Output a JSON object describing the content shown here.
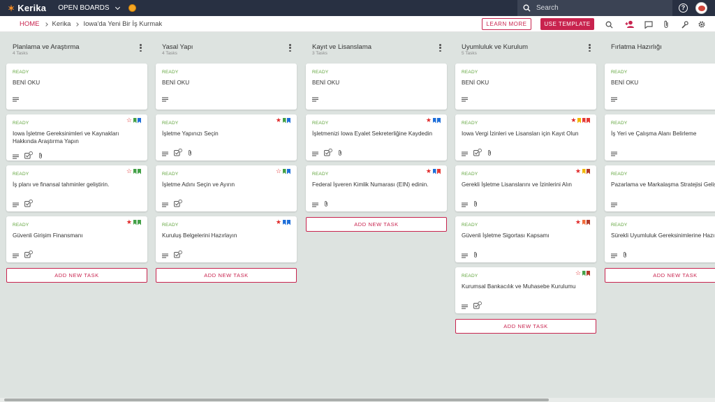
{
  "app": {
    "logo_text": "Kerika",
    "open_boards": "OPEN BOARDS",
    "search_placeholder": "Search"
  },
  "breadcrumb": {
    "home": "HOME",
    "org": "Kerika",
    "board": "Iowa'da Yeni Bir İş Kurmak"
  },
  "actions": {
    "learn_more": "LEARN MORE",
    "use_template": "USE TEMPLATE"
  },
  "colors": {
    "accent": "#c8234e",
    "topbar": "#283042",
    "ready": "#5fa33a",
    "board_bg": "#dde3e0"
  },
  "columns": [
    {
      "title": "Planlama ve Araştırma",
      "count": "4 Tasks",
      "add_label": "ADD NEW TASK",
      "cards": [
        {
          "status": "READY",
          "title": "BENİ OKU",
          "icons": [
            "desc"
          ],
          "flags": []
        },
        {
          "status": "READY",
          "title": "Iowa İşletme Gereksinimleri ve Kaynakları Hakkında Araştırma Yapın",
          "icons": [
            "desc",
            "check",
            "attach"
          ],
          "flags": [
            "star-outline",
            "#43a047",
            "#1e6fd9"
          ]
        },
        {
          "status": "READY",
          "title": "İş planı ve finansal tahminler geliştirin.",
          "icons": [
            "desc",
            "check"
          ],
          "flags": [
            "star-outline",
            "#43a047",
            "#43a047"
          ]
        },
        {
          "status": "READY",
          "title": "Güvenli Girişim Finansmanı",
          "icons": [
            "desc",
            "check"
          ],
          "flags": [
            "star",
            "#43a047",
            "#43a047"
          ]
        }
      ]
    },
    {
      "title": "Yasal Yapı",
      "count": "4 Tasks",
      "add_label": "ADD NEW TASK",
      "cards": [
        {
          "status": "READY",
          "title": "BENİ OKU",
          "icons": [
            "desc"
          ],
          "flags": []
        },
        {
          "status": "READY",
          "title": "İşletme Yapınızı Seçin",
          "icons": [
            "desc",
            "check",
            "attach"
          ],
          "flags": [
            "star",
            "#43a047",
            "#1e6fd9"
          ]
        },
        {
          "status": "READY",
          "title": "İşletme Adını Seçin ve Ayırın",
          "icons": [
            "desc",
            "check"
          ],
          "flags": [
            "star-outline",
            "#43a047",
            "#1e6fd9"
          ]
        },
        {
          "status": "READY",
          "title": "Kuruluş Belgelerini Hazırlayın",
          "icons": [
            "desc",
            "check"
          ],
          "flags": [
            "star",
            "#1e6fd9",
            "#1e6fd9"
          ]
        }
      ]
    },
    {
      "title": "Kayıt ve Lisanslama",
      "count": "3 Tasks",
      "add_label": "ADD NEW TASK",
      "cards": [
        {
          "status": "READY",
          "title": "BENİ OKU",
          "icons": [
            "desc"
          ],
          "flags": []
        },
        {
          "status": "READY",
          "title": "İşletmenizi Iowa Eyalet Sekreterliğine Kaydedin",
          "icons": [
            "desc",
            "check",
            "attach"
          ],
          "flags": [
            "star",
            "#1e6fd9",
            "#1e6fd9"
          ]
        },
        {
          "status": "READY",
          "title": "Federal İşveren Kimlik Numarası (EIN) edinin.",
          "icons": [
            "desc",
            "attach"
          ],
          "flags": [
            "star",
            "#1e6fd9",
            "#e53935"
          ]
        }
      ]
    },
    {
      "title": "Uyumluluk ve Kurulum",
      "count": "5 Tasks",
      "add_label": "ADD NEW TASK",
      "cards": [
        {
          "status": "READY",
          "title": "BENİ OKU",
          "icons": [
            "desc"
          ],
          "flags": []
        },
        {
          "status": "READY",
          "title": "Iowa Vergi İzinleri ve Lisansları için Kayıt Olun",
          "icons": [
            "desc",
            "check",
            "attach"
          ],
          "flags": [
            "star",
            "#f2b705",
            "#e53935",
            "#e53935"
          ]
        },
        {
          "status": "READY",
          "title": "Gerekli İşletme Lisanslarını ve İzinlerini Alın",
          "icons": [
            "desc",
            "attach"
          ],
          "flags": [
            "star",
            "#f2b705",
            "#b23a2a"
          ]
        },
        {
          "status": "READY",
          "title": "Güvenli İşletme Sigortası Kapsamı",
          "icons": [
            "desc",
            "attach"
          ],
          "flags": [
            "star",
            "#f26b3a",
            "#b23a2a"
          ]
        },
        {
          "status": "READY",
          "title": "Kurumsal Bankacılık ve Muhasebe Kurulumu",
          "icons": [
            "desc",
            "check"
          ],
          "flags": [
            "star-outline",
            "#43a047",
            "#b23a2a"
          ]
        }
      ]
    },
    {
      "title": "Fırlatma Hazırlığı",
      "count": "",
      "add_label": "ADD NEW TASK",
      "cards": [
        {
          "status": "READY",
          "title": "BENİ OKU",
          "icons": [
            "desc"
          ],
          "flags": []
        },
        {
          "status": "READY",
          "title": "İş Yeri ve Çalışma Alanı Belirleme",
          "icons": [
            "desc"
          ],
          "flags": []
        },
        {
          "status": "READY",
          "title": "Pazarlama ve Markalaşma Stratejisi Geliştirme",
          "icons": [
            "desc"
          ],
          "flags": []
        },
        {
          "status": "READY",
          "title": "Sürekli Uyumluluk Gereksinimlerine Hazırlık",
          "icons": [
            "desc",
            "attach"
          ],
          "flags": []
        }
      ]
    }
  ]
}
